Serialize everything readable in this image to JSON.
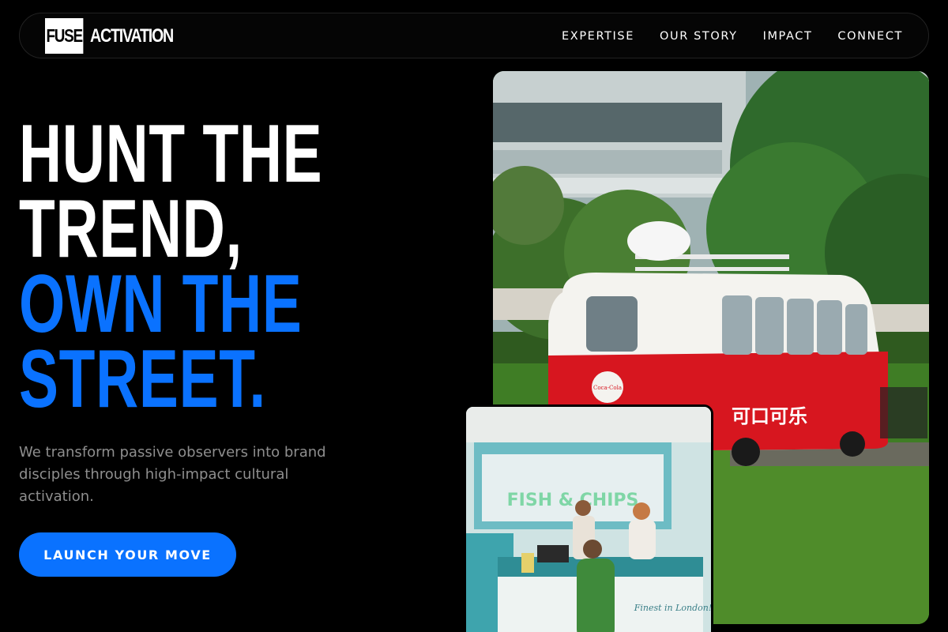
{
  "nav": {
    "logo_box": "FUSE",
    "logo_text": "ACTIVATION",
    "links": [
      "EXPERTISE",
      "OUR STORY",
      "IMPACT",
      "CONNECT"
    ]
  },
  "hero": {
    "headline_white": [
      "HUNT THE",
      "TREND,"
    ],
    "headline_blue": [
      "OWN THE",
      "STREET."
    ],
    "subtext": "We transform passive observers into brand disciples through high-impact cultural activation.",
    "cta_label": "LAUNCH YOUR MOVE"
  },
  "images": {
    "main_van_brand": "Coca-Cola",
    "main_van_script": "可口可乐",
    "inset_sign": "FISH & CHIPS",
    "inset_slogan": "Finest in London!"
  },
  "colors": {
    "background": "#000000",
    "accent_blue": "#0a72ff",
    "subtext_gray": "#8e8e8e"
  }
}
